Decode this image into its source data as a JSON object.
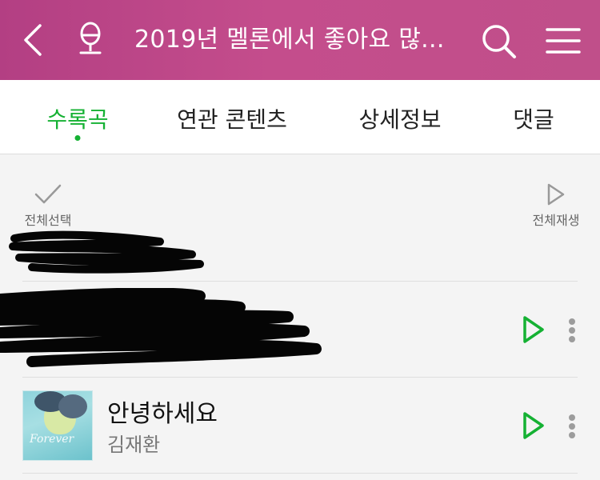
{
  "header": {
    "title": "2019년 멜론에서 좋아요 많...",
    "icons": [
      "back-icon",
      "mic-icon",
      "search-icon",
      "menu-icon"
    ],
    "background_colors": [
      "#b33f83",
      "#c44d8c"
    ]
  },
  "tabs": [
    {
      "label": "수록곡",
      "active": true
    },
    {
      "label": "연관 콘텐츠",
      "active": false
    },
    {
      "label": "상세정보",
      "active": false
    },
    {
      "label": "댓글",
      "active": false
    }
  ],
  "controls": {
    "select_all_label": "전체선택",
    "play_all_label": "전체재생"
  },
  "songs": [
    {
      "title": "안녕하세요",
      "artist": "김재환",
      "album_art_text": "Forever"
    }
  ],
  "colors": {
    "accent": "#15b133",
    "text": "#222222",
    "muted": "#777777"
  }
}
